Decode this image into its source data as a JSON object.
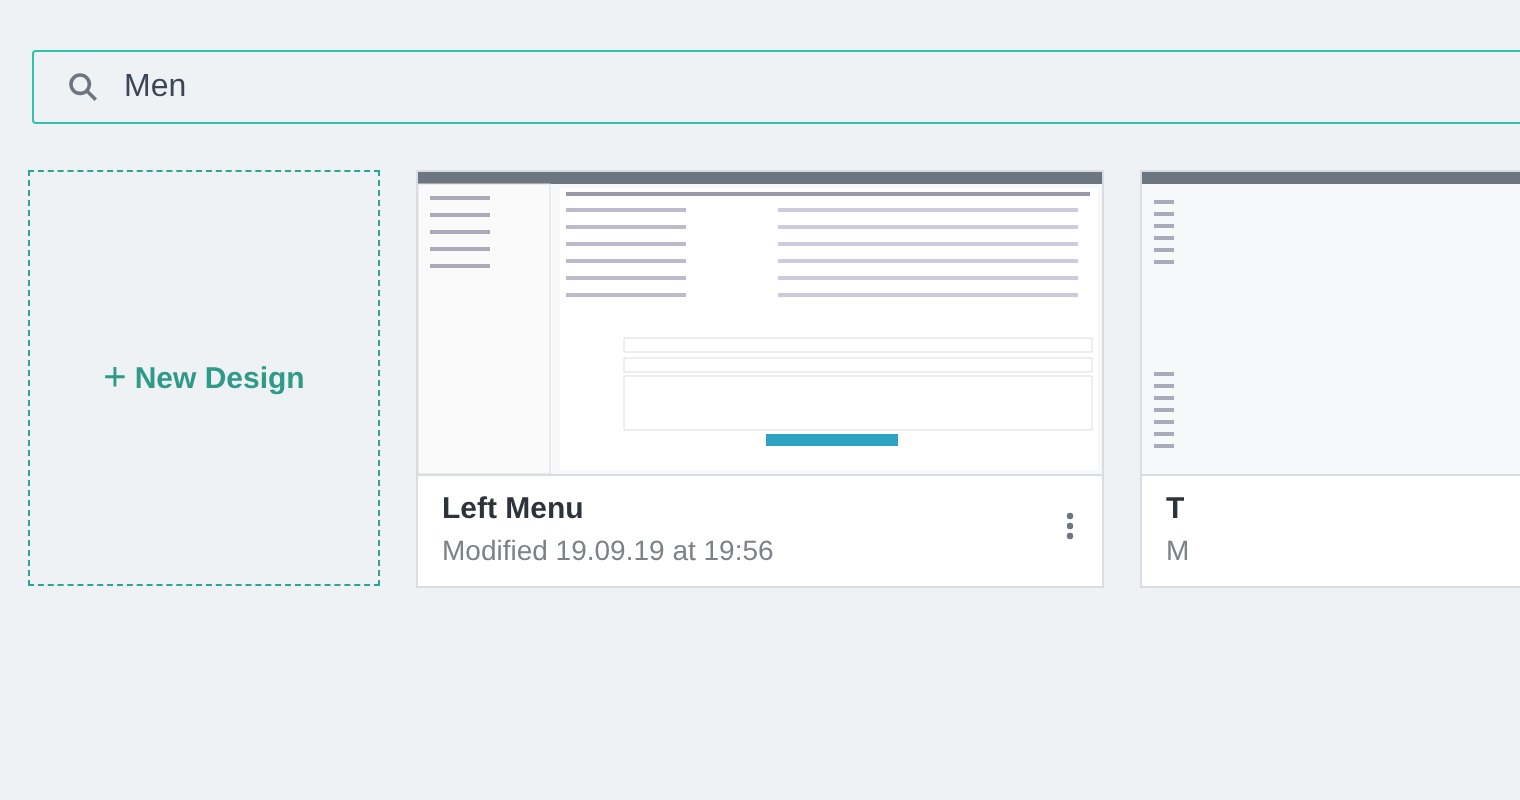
{
  "search": {
    "value": "Men"
  },
  "new_design": {
    "icon": "+",
    "label": "New Design"
  },
  "designs": [
    {
      "title": "Left Menu",
      "modified": "Modified 19.09.19 at 19:56",
      "kind": "left-menu"
    },
    {
      "title": "T",
      "modified": "M",
      "kind": "top"
    }
  ]
}
